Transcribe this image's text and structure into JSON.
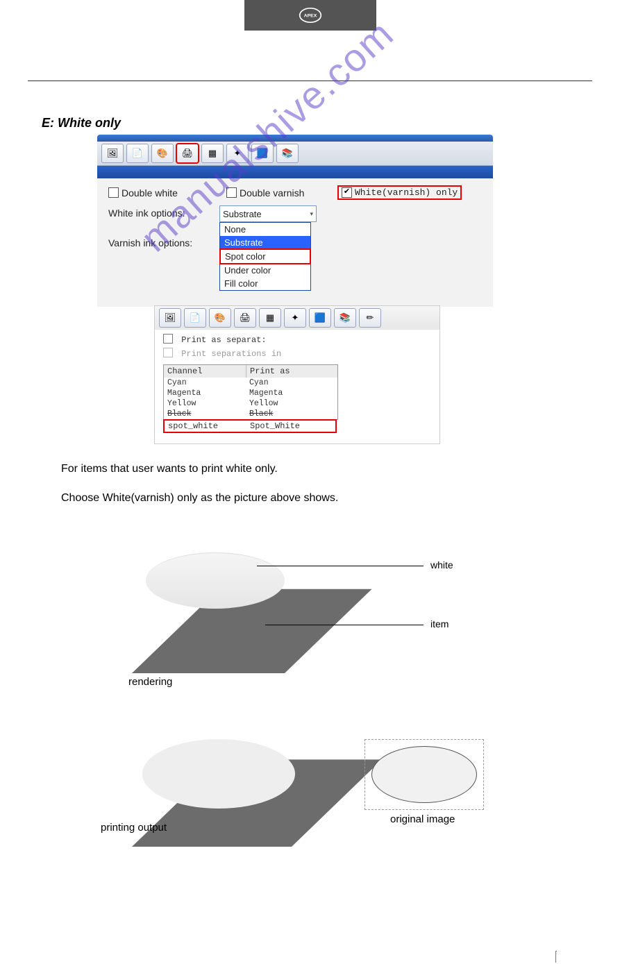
{
  "header": {
    "logo_text": "APEX"
  },
  "section_title": "E: White only",
  "watermark": "manualshive.com",
  "screenshot1": {
    "chk_double_white": "Double white",
    "chk_double_varnish": "Double varnish",
    "chk_white_varnish_only": "White(varnish) only",
    "label_white_ink": "White ink options:",
    "label_varnish_ink": "Varnish ink options:",
    "combo_value": "Substrate",
    "dropdown": {
      "none": "None",
      "substrate": "Substrate",
      "spot_color": "Spot color",
      "under_color": "Under color",
      "fill_color": "Fill color"
    }
  },
  "screenshot2": {
    "chk_print_as_separat": "Print as separat:",
    "chk_print_separations_in": "Print separations in",
    "table": {
      "head_channel": "Channel",
      "head_printas": "Print as",
      "rows": [
        {
          "c": "Cyan",
          "p": "Cyan"
        },
        {
          "c": "Magenta",
          "p": "Magenta"
        },
        {
          "c": "Yellow",
          "p": "Yellow"
        },
        {
          "c": "Black",
          "p": "Black"
        },
        {
          "c": "spot_white",
          "p": "Spot_White"
        }
      ]
    }
  },
  "body_text": {
    "line1": "For items that user wants to print white only.",
    "line2": "Choose White(varnish) only as the picture above shows."
  },
  "diagram": {
    "label_white": "white",
    "label_item": "item",
    "caption_rendering": "rendering",
    "caption_printing_output": "printing output",
    "caption_original_image": "original image"
  }
}
